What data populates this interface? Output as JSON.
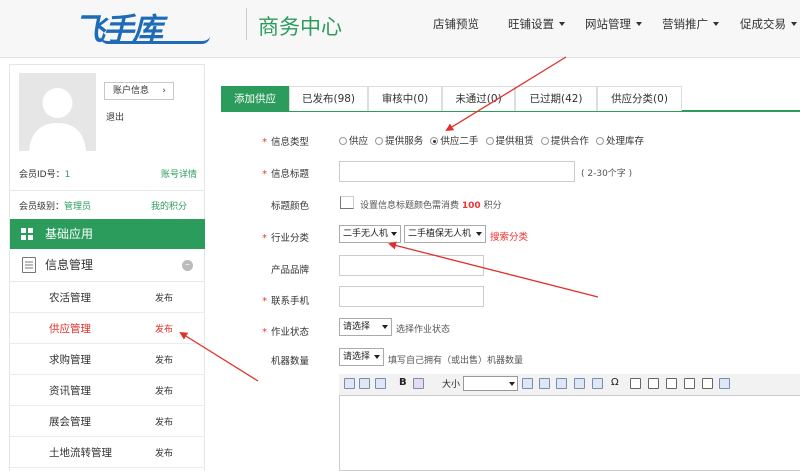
{
  "header": {
    "logo_text": "飞手库",
    "title": "商务中心",
    "nav": [
      "店铺预览",
      "旺铺设置",
      "网站管理",
      "营销推广",
      "促成交易"
    ]
  },
  "sidebar": {
    "account_btn": "账户信息",
    "logout": "退出",
    "member_id_label": "会员ID号：",
    "member_id": "1",
    "account_detail": "账号详情",
    "level_label": "会员级别：",
    "level": "管理员",
    "my_points": "我的积分",
    "basic_app": "基础应用",
    "info_mgmt": "信息管理",
    "menu": [
      {
        "label": "农活管理",
        "action": "发布"
      },
      {
        "label": "供应管理",
        "action": "发布"
      },
      {
        "label": "求购管理",
        "action": "发布"
      },
      {
        "label": "资讯管理",
        "action": "发布"
      },
      {
        "label": "展会管理",
        "action": "发布"
      },
      {
        "label": "土地流转管理",
        "action": "发布"
      }
    ]
  },
  "tabs": [
    "添加供应",
    "已发布(98)",
    "审核中(0)",
    "未通过(0)",
    "已过期(42)",
    "供应分类(0)"
  ],
  "form": {
    "req_mark": "*",
    "info_type_label": "信息类型",
    "info_types": [
      "供应",
      "提供服务",
      "供应二手",
      "提供租赁",
      "提供合作",
      "处理库存"
    ],
    "info_type_selected": "供应二手",
    "title_label": "信息标题",
    "title_hint": "( 2-30个字 )",
    "color_label": "标题颜色",
    "color_hint_pre": "设置信息标题颜色需消费",
    "color_cost": "100",
    "color_hint_post": "积分",
    "category_label": "行业分类",
    "category_1": "二手无人机",
    "category_2": "二手植保无人机",
    "search_category": "搜索分类",
    "brand_label": "产品品牌",
    "phone_label": "联系手机",
    "status_label": "作业状态",
    "status_select": "请选择",
    "status_hint": "选择作业状态",
    "machine_label": "机器数量",
    "machine_select": "请选择",
    "machine_hint": "填写自己拥有（或出售）机器数量"
  },
  "editor": {
    "bold": "B",
    "fontsize_label": "大小",
    "omega": "Ω"
  },
  "colors": {
    "brand_green": "#2c9c5d",
    "logo_blue": "#1e6bb8",
    "accent_red": "#e33",
    "annotation_red": "#e0302a"
  }
}
